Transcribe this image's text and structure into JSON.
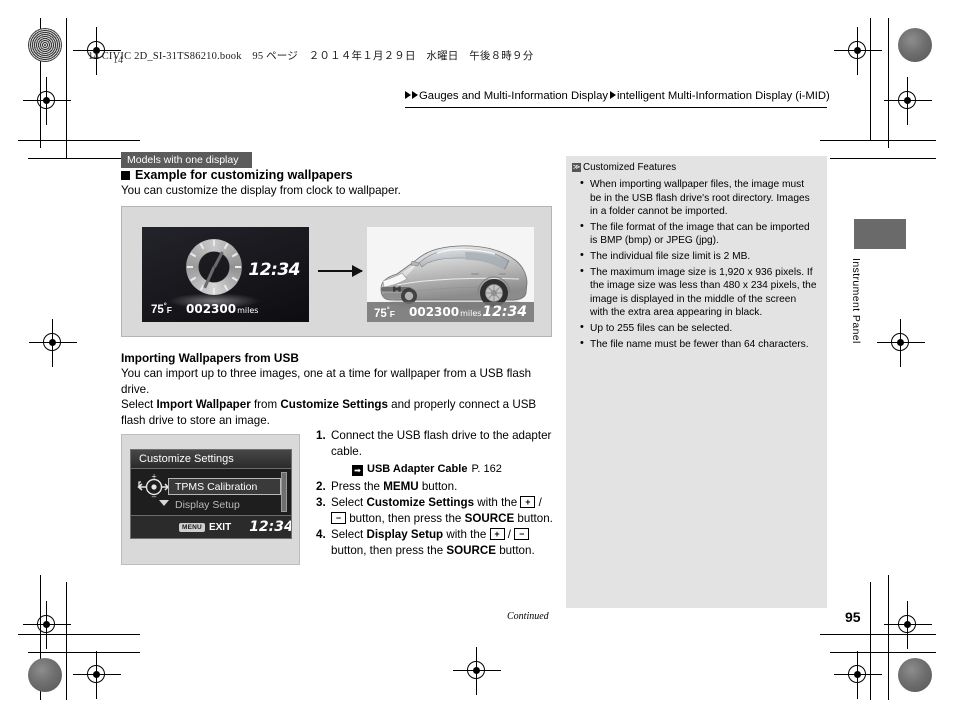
{
  "print": {
    "imprint": "14 CIVIC 2D_SI-31TS86210.book　95 ページ　２０１４年１月２９日　水曜日　午後８時９分",
    "mark_number": "14"
  },
  "breadcrumb": {
    "item1": "Gauges and Multi-Information Display",
    "item2": "intelligent Multi-Information Display (i-MID)"
  },
  "left": {
    "badge": "Models with one display",
    "section_heading": "Example for customizing wallpapers",
    "intro": "You can customize the display from clock to wallpaper.",
    "sub_heading": "Importing Wallpapers from USB",
    "para1": "You can import up to three images, one at a time for wallpaper from a USB flash drive.",
    "para2_pre": "Select ",
    "para2_b1": "Import Wallpaper",
    "para2_mid": " from ",
    "para2_b2": "Customize Settings",
    "para2_post": " and properly connect a USB flash drive to store an image."
  },
  "display": {
    "temp": "75",
    "temp_deg": "°",
    "temp_unit": "F",
    "odometer": "002300",
    "odometer_unit": "miles",
    "time": "12:34"
  },
  "menu_screen": {
    "title": "Customize Settings",
    "selected_item": "TPMS Calibration",
    "second_item": "Display Setup",
    "menu_chip": "MENU",
    "exit_label": "EXIT",
    "time": "12:34"
  },
  "steps": [
    {
      "num": "1.",
      "text": "Connect the USB flash drive to the adapter cable.",
      "ref": {
        "icon": "➡",
        "bold": "USB Adapter Cable",
        "page": "P. 162"
      }
    },
    {
      "num": "2.",
      "pre": "Press the ",
      "bold1": "MEMU",
      "post": " button."
    },
    {
      "num": "3.",
      "pre": "Select ",
      "bold1": "Customize Settings",
      "mid1": " with the ",
      "key1": "+",
      "sep": " / ",
      "key2": "−",
      "mid2": " button, then press the ",
      "bold2": "SOURCE",
      "post": " button."
    },
    {
      "num": "4.",
      "pre": "Select ",
      "bold1": "Display Setup",
      "mid1": " with the ",
      "key1": "+",
      "sep": " / ",
      "key2": "−",
      "mid2": " button, then press the ",
      "bold2": "SOURCE",
      "post": " button."
    }
  ],
  "notes": {
    "title": "Customized Features",
    "icon": "≫",
    "items": [
      "When importing wallpaper files, the image must be in the USB flash drive's root directory. Images in a folder cannot be imported.",
      "The file format of the image that can be imported is BMP (bmp) or JPEG (jpg).",
      "The individual file size limit is 2 MB.",
      "The maximum image size is 1,920 x 936 pixels. If the image size was less than 480 x 234 pixels, the image is displayed in the middle of the screen with the extra area appearing in black.",
      "Up to 255 files can be selected.",
      "The file name must be fewer than 64 characters."
    ]
  },
  "edge_tab": {
    "label": "Instrument Panel"
  },
  "footer": {
    "continued": "Continued",
    "page_number": "95"
  },
  "colors": {
    "badge_bg": "#5b5b5b",
    "note_panel_bg": "#e3e3e3",
    "figure_bg": "#d9d9d9",
    "tab_block": "#6a6a6a"
  }
}
